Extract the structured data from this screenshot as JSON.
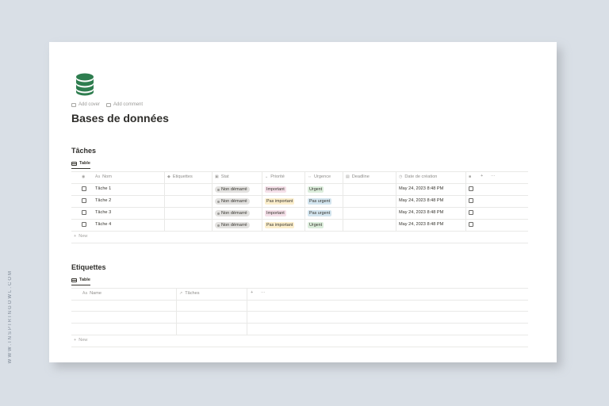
{
  "watermark": "WWW.INSPIRINGOWL.COM",
  "colors": {
    "icon_green": "#2e7d4f",
    "important_bg": "#f5e0e9",
    "pas_important_bg": "#fbeecc",
    "urgent_bg": "#dbeddb",
    "pas_urgent_bg": "#d3e5ef"
  },
  "page": {
    "icon": "database-icon",
    "add_cover": "Add cover",
    "add_comment": "Add comment",
    "title": "Bases de données"
  },
  "taches": {
    "title": "Tâches",
    "view_tab": "Table",
    "headers": {
      "nom": "Nom",
      "etiquettes": "Etiquettes",
      "stat": "Stat",
      "priorite": "Priorité",
      "urgence": "Urgence",
      "deadline": "Deadline",
      "date_creation": "Date de création"
    },
    "rows": [
      {
        "nom": "Tâche 1",
        "stat": "Non démarré",
        "priorite": "Important",
        "urgence": "Urgent",
        "date": "May 24, 2023 8:48 PM"
      },
      {
        "nom": "Tâche 2",
        "stat": "Non démarré",
        "priorite": "Pas important",
        "urgence": "Pas urgent",
        "date": "May 24, 2023 8:48 PM"
      },
      {
        "nom": "Tâche 3",
        "stat": "Non démarré",
        "priorite": "Important",
        "urgence": "Pas urgent",
        "date": "May 24, 2023 8:48 PM"
      },
      {
        "nom": "Tâche 4",
        "stat": "Non démarré",
        "priorite": "Pas important",
        "urgence": "Urgent",
        "date": "May 24, 2023 8:48 PM"
      }
    ],
    "new_label": "New",
    "add_column": "+",
    "more": "···"
  },
  "etiquettes": {
    "title": "Etiquettes",
    "view_tab": "Table",
    "headers": {
      "name": "Name",
      "taches": "Tâches"
    },
    "new_label": "New",
    "add_column": "+",
    "more": "···"
  }
}
